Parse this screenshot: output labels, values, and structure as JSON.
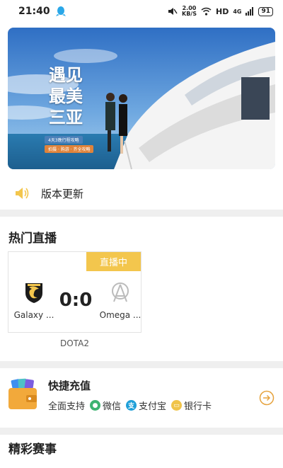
{
  "status_bar": {
    "time": "21:40",
    "speed_value": "2.00",
    "speed_unit": "KB/S",
    "network": "HD",
    "signal": "4G",
    "battery": "91"
  },
  "banner": {
    "title_line1": "遇见",
    "title_line2": "最美",
    "title_line3": "三亚",
    "tag1": "4天3晚行程攻略",
    "tag2": "拍摄 · 购游 · 齐全攻略"
  },
  "notice": {
    "label": "版本更新"
  },
  "live": {
    "section_title": "热门直播",
    "badge": "直播中",
    "team_left": "Galaxy ...",
    "team_right": "Omega ...",
    "score": "0:0",
    "game": "DOTA2"
  },
  "recharge": {
    "title": "快捷充值",
    "support_label": "全面支持",
    "methods": [
      {
        "label": "微信",
        "icon": "wechat-icon",
        "color": "#3cb371",
        "glyph": "●"
      },
      {
        "label": "支付宝",
        "icon": "alipay-icon",
        "color": "#1e9fd8",
        "glyph": "支"
      },
      {
        "label": "银行卡",
        "icon": "bankcard-icon",
        "color": "#f0c44a",
        "glyph": "▭"
      }
    ]
  },
  "events": {
    "section_title": "精彩赛事"
  },
  "colors": {
    "accent_yellow": "#f3c64d",
    "arrow_orange": "#e6a23c"
  }
}
